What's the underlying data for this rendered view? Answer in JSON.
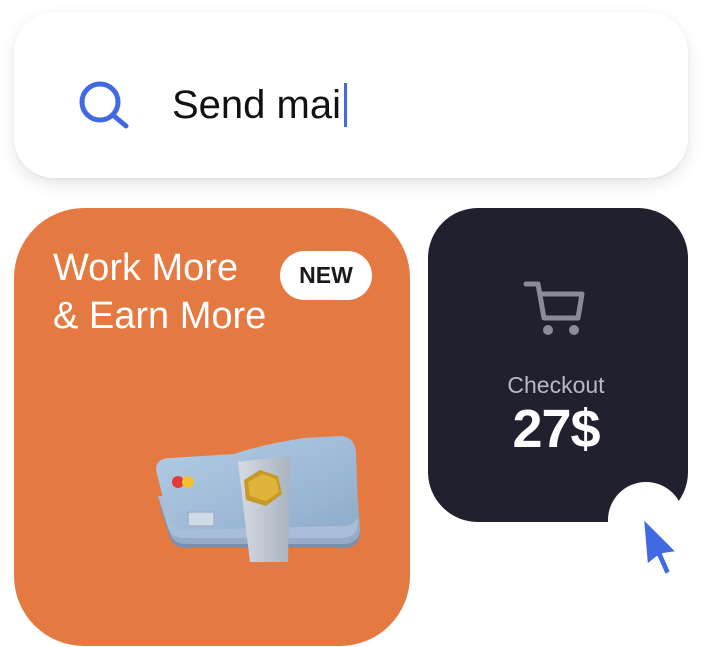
{
  "search": {
    "value": "Send mai",
    "icon": "search-icon",
    "accent_color": "#4169e1"
  },
  "promo": {
    "title": "Work More\n& Earn More",
    "badge": "NEW",
    "background_color": "#e47a41",
    "illustration": "payment-cards-stack"
  },
  "checkout": {
    "icon": "shopping-cart-icon",
    "label": "Checkout",
    "amount": "27$",
    "background_color": "#20202f"
  },
  "cursor": {
    "icon": "mouse-pointer-icon",
    "color": "#4169e1"
  }
}
